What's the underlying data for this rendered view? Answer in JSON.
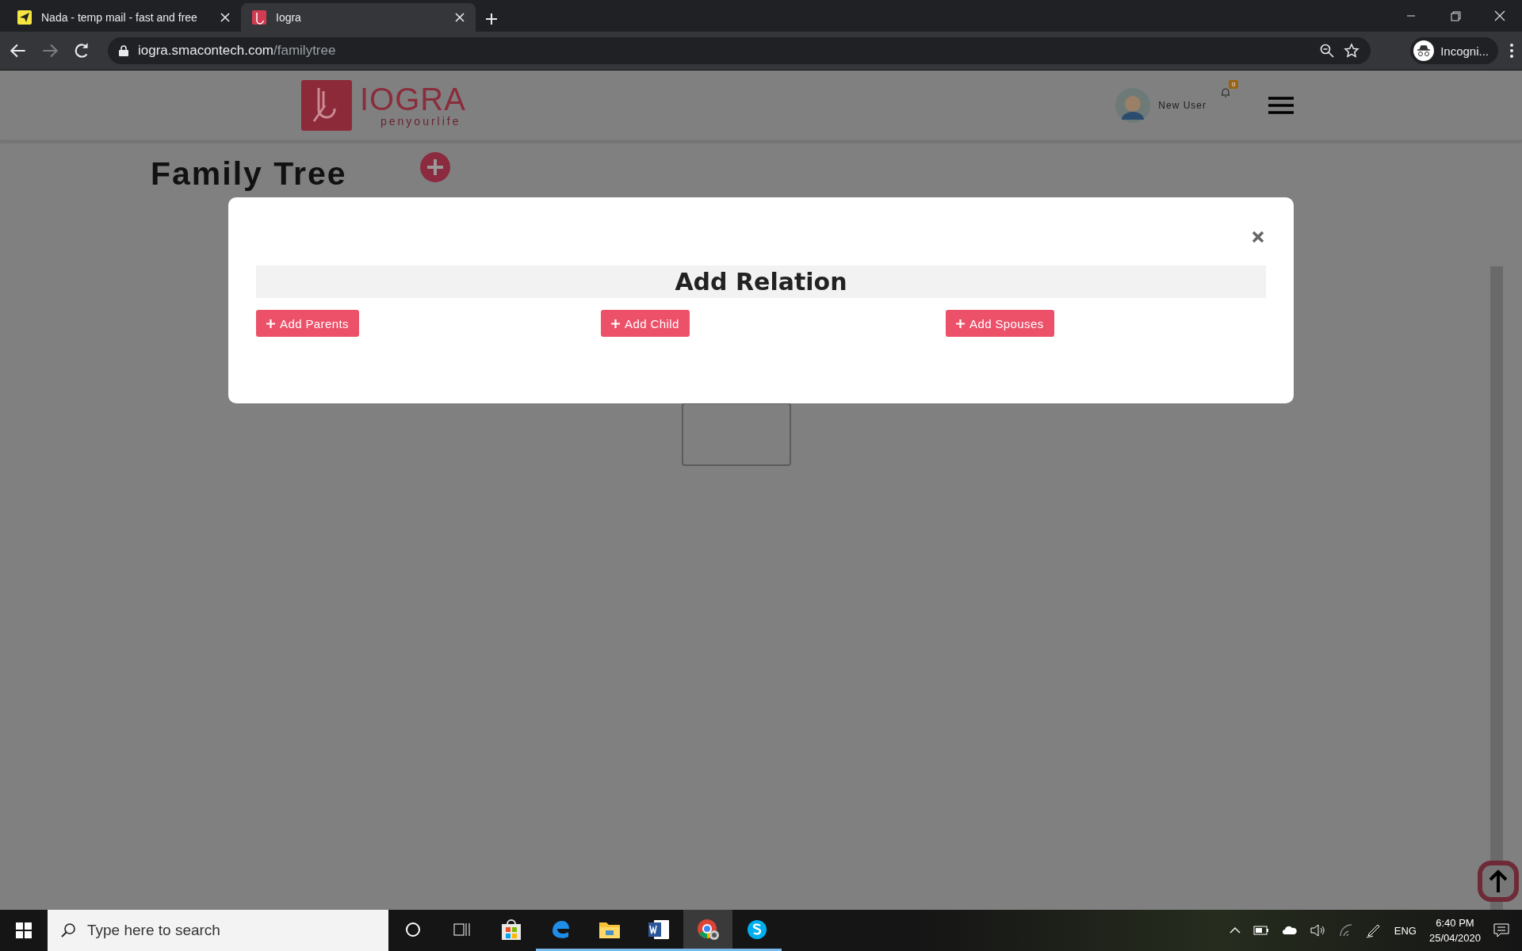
{
  "browser": {
    "tabs": [
      {
        "title": "Nada - temp mail - fast and free",
        "kind": "mail",
        "selected": false
      },
      {
        "title": "Iogra",
        "kind": "iogra",
        "selected": true
      }
    ],
    "address": {
      "host": "iogra.smacontech.com",
      "path": "/familytree"
    },
    "profile": "Incogni..."
  },
  "header": {
    "logo": {
      "name": "IOGRA",
      "tagline": "penyourlife"
    },
    "user": "New User",
    "notifications": "0"
  },
  "page": {
    "title": "Family Tree"
  },
  "modal": {
    "title": "Add Relation",
    "buttons": [
      {
        "label": "Add Parents"
      },
      {
        "label": "Add Child"
      },
      {
        "label": "Add Spouses"
      }
    ]
  },
  "taskbar": {
    "search": {
      "placeholder": "Type here to search"
    },
    "apps": [
      {
        "kind": "store",
        "running": false,
        "selected": false
      },
      {
        "kind": "edge",
        "running": true,
        "selected": false
      },
      {
        "kind": "explorer",
        "running": true,
        "selected": false
      },
      {
        "kind": "word",
        "running": true,
        "selected": false
      },
      {
        "kind": "chrome",
        "running": true,
        "selected": true
      },
      {
        "kind": "skype",
        "running": true,
        "selected": false
      }
    ],
    "tray": {
      "language": "ENG",
      "time": "6:40 PM",
      "date": "25/04/2020"
    }
  }
}
